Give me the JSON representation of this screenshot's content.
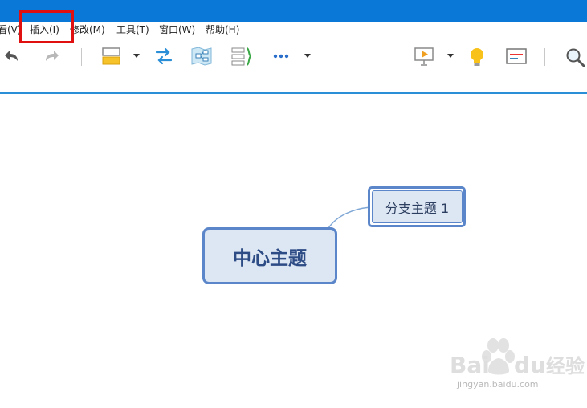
{
  "menu": {
    "items": [
      {
        "label": "看(V)"
      },
      {
        "label": "插入(I)"
      },
      {
        "label": "修改(M)"
      },
      {
        "label": "工具(T)"
      },
      {
        "label": "窗口(W)"
      },
      {
        "label": "帮助(H)"
      }
    ]
  },
  "toolbar": {
    "icons": [
      "undo-icon",
      "redo-icon",
      "insert-topic-icon",
      "dropdown-arrow-icon",
      "relationship-icon",
      "structure-icon",
      "boundary-summary-icon",
      "more-icon",
      "dropdown-arrow-icon",
      "presentation-icon",
      "dropdown-arrow-icon",
      "lightbulb-icon",
      "format-panel-icon",
      "search-icon"
    ]
  },
  "mindmap": {
    "central_topic": "中心主题",
    "branch_topic": "分支主题 1"
  },
  "watermark": {
    "text": "jingyan.baidu.com"
  },
  "colors": {
    "title_bar": "#0a78d7",
    "accent_line": "#2b8fd8",
    "topic_border": "#5b86c9",
    "topic_fill": "#dde6f3",
    "highlight": "#e01010"
  }
}
